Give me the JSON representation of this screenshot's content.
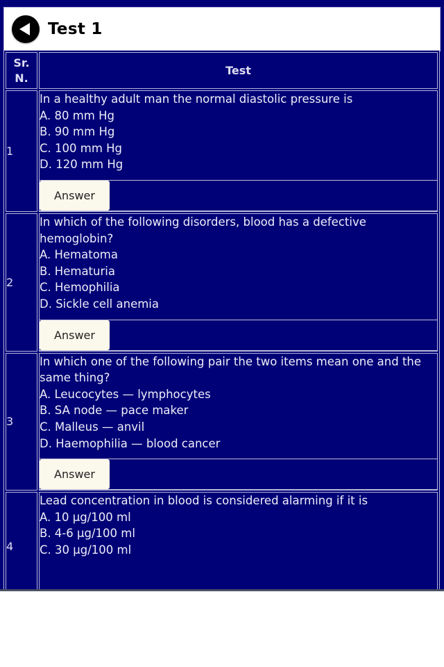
{
  "header": {
    "back_icon": "back-arrow-icon",
    "title": "Test 1"
  },
  "table": {
    "headers": {
      "sr": "Sr. N.",
      "test": "Test"
    },
    "answer_label": "Answer",
    "rows": [
      {
        "sr": "1",
        "question": "In a healthy adult man the normal diastolic pressure is",
        "options": [
          "A. 80 mm Hg",
          "B. 90 mm Hg",
          "C. 100 mm Hg",
          "D. 120 mm Hg"
        ]
      },
      {
        "sr": "2",
        "question": "In which of the following disorders, blood has a defective hemoglobin?",
        "options": [
          "A. Hematoma",
          "B. Hematuria",
          "C. Hemophilia",
          "D. Sickle cell anemia"
        ]
      },
      {
        "sr": "3",
        "question": "In which one of the following pair the two items mean one and the same thing?",
        "options": [
          "A. Leucocytes — lymphocytes",
          "B. SA node — pace maker",
          "C. Malleus — anvil",
          "D. Haemophilia — blood cancer"
        ]
      },
      {
        "sr": "4",
        "question": "Lead concentration in blood is considered alarming if it is",
        "options": [
          "A. 10 µg/100 ml",
          "B. 4-6 µg/100 ml",
          "C. 30 µg/100 ml"
        ]
      }
    ]
  }
}
